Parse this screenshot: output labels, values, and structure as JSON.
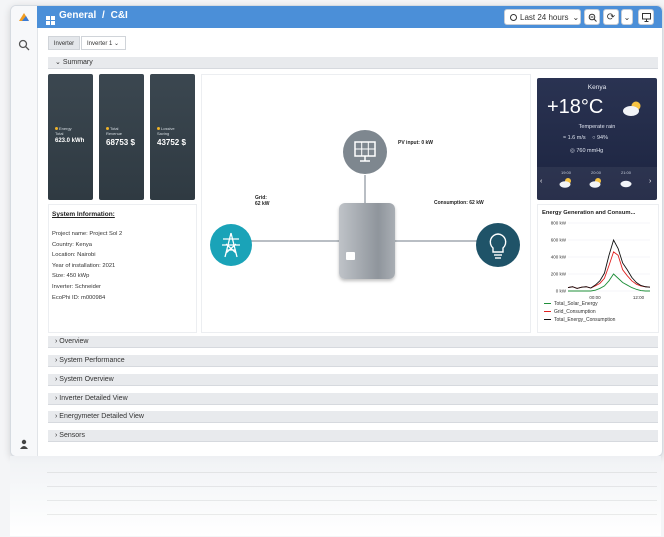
{
  "header": {
    "title": "General",
    "separator": "/",
    "subtitle": "C&I",
    "time_range": "Last 24 hours"
  },
  "tabs": [
    {
      "label": "Inverter"
    },
    {
      "label": "Inverter 1"
    }
  ],
  "summary_label": "Summary",
  "tiles": [
    {
      "label_line1": "Energy",
      "label_line2": "Total",
      "value": "623.0 kWh"
    },
    {
      "label_line1": "Total",
      "label_line2": "Revenue",
      "value": "68753 $"
    },
    {
      "label_line1": "Lossive",
      "label_line2": "Saving",
      "value": "43752 $"
    }
  ],
  "system_info": {
    "title": "System Information:",
    "lines": [
      "Project name: Project Sol 2",
      "Country: Kenya",
      "Location: Nairobi",
      "Year of installation: 2021",
      "Size: 450 kWp",
      "Inverter: Schneider",
      "EcoPhi ID: m000984"
    ]
  },
  "diagram": {
    "pv_label": "PV input: 0 kW",
    "grid_label_1": "Grid:",
    "grid_label_2": "62 kW",
    "consumption_label": "Consumption: 62 kW"
  },
  "weather": {
    "location": "Kenya",
    "temperature": "+18°C",
    "condition": "Temperate rain",
    "wind": "1.6 m/s",
    "humidity": "94%",
    "pressure": "760 mmHg",
    "forecast": [
      "19:00",
      "20:00",
      "21:00"
    ]
  },
  "energy_chart": {
    "title": "Energy Generation and Consum...",
    "colors": {
      "solar": "#1f8f3a",
      "grid": "#e02020",
      "consumption": "#111111"
    }
  },
  "chart_data": {
    "type": "line",
    "title": "Energy Generation and Consum...",
    "y_ticks": [
      "800 kW",
      "600 kW",
      "400 kW",
      "200 kW",
      "0 kW"
    ],
    "ylim": [
      0,
      800
    ],
    "x_ticks": [
      "00:00",
      "12:00"
    ],
    "x": [
      0,
      2,
      4,
      6,
      8,
      10,
      12,
      14,
      16,
      18,
      20,
      22,
      24,
      26,
      28,
      30,
      32,
      34,
      36
    ],
    "series": [
      {
        "name": "Total_Solar_Energy",
        "values": [
          0,
          0,
          0,
          0,
          0,
          0,
          10,
          30,
          60,
          120,
          200,
          150,
          100,
          70,
          40,
          20,
          5,
          0,
          0
        ]
      },
      {
        "name": "Grid_Consumption",
        "values": [
          40,
          50,
          30,
          45,
          50,
          35,
          60,
          90,
          150,
          300,
          460,
          420,
          250,
          180,
          120,
          80,
          60,
          50,
          45
        ]
      },
      {
        "name": "Total_Energy_Consumption",
        "values": [
          40,
          50,
          30,
          45,
          50,
          35,
          70,
          120,
          210,
          420,
          600,
          500,
          330,
          250,
          160,
          100,
          65,
          50,
          45
        ]
      }
    ],
    "legend_placement": "bottom"
  },
  "sections": [
    "Overview",
    "System Performance",
    "System Overview",
    "Inverter Detailed View",
    "Energymeter Detailed View",
    "Sensors"
  ]
}
